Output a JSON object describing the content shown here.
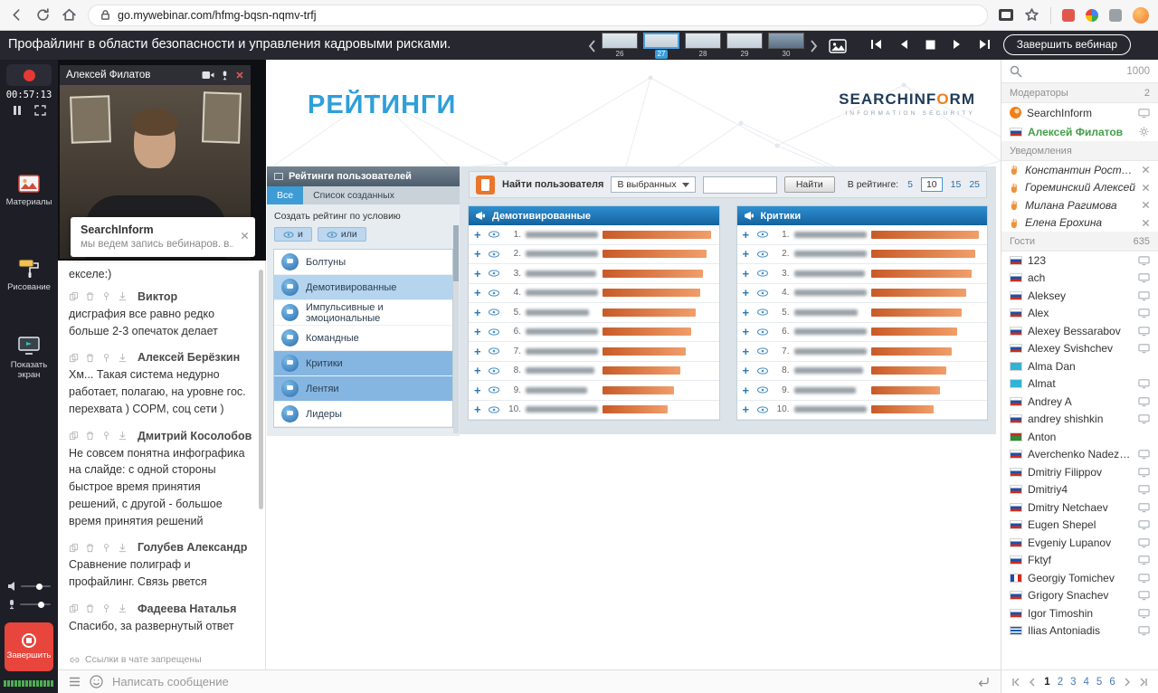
{
  "browser": {
    "url": "go.mywebinar.com/hfmg-bqsn-nqmv-trfj"
  },
  "header": {
    "title": "Профайлинг в области безопасности и управления кадровыми рисками.",
    "slide_numbers": [
      "26",
      "27",
      "28",
      "29",
      "30"
    ],
    "active_slide": "27",
    "end_webinar_label": "Завершить вебинар"
  },
  "left_rail": {
    "timer": "00:57:13",
    "materials_label": "Материалы",
    "drawing_label": "Рисование",
    "screen_label": "Показать экран",
    "end_label": "Завершить"
  },
  "video": {
    "presenter_name": "Алексей Филатов"
  },
  "chat": {
    "pinned": {
      "author": "SearchInform",
      "text": "мы ведем запись вебинаров. в..."
    },
    "partial_message": "екселе:)",
    "messages": [
      {
        "author": "Виктор",
        "text": "дисграфия все равно редко больше 2-3 опечаток делает"
      },
      {
        "author": "Алексей Берёзкин",
        "text": "Хм... Такая система недурно работает, полагаю, на уровне гос. перехвата ) СОРМ, соц сети )"
      },
      {
        "author": "Дмитрий Косолобов",
        "text": "Не совсем понятна инфографика на слайде: с одной стороны быстрое время принятия решений, с другой - большое время принятия решений"
      },
      {
        "author": "Голубев Александр",
        "text": "Сравнение полиграф и профайлинг. Связь рвется"
      },
      {
        "author": "Фадеева Наталья",
        "text": "Спасибо, за развернутый ответ"
      }
    ],
    "links_note": "Ссылки в чате запрещены",
    "input_placeholder": "Написать сообщение"
  },
  "slide": {
    "title": "РЕЙТИНГИ",
    "logo_part1": "SEARCHINF",
    "logo_o": "O",
    "logo_part2": "RM",
    "logo_tagline": "INFORMATION SECURITY",
    "app": {
      "panel_title": "Рейтинги пользователей",
      "tabs": [
        "Все",
        "Список созданных"
      ],
      "create_label": "Создать рейтинг по условию",
      "toggle_and": "и",
      "toggle_or": "или",
      "categories": [
        {
          "label": "Болтуны",
          "state": "none"
        },
        {
          "label": "Демотивированные",
          "state": "selected"
        },
        {
          "label": "Импульсивные и эмоциональные",
          "state": "none"
        },
        {
          "label": "Командные",
          "state": "none"
        },
        {
          "label": "Критики",
          "state": "active"
        },
        {
          "label": "Лентяи",
          "state": "active"
        },
        {
          "label": "Лидеры",
          "state": "none"
        }
      ],
      "toolbar": {
        "find_label": "Найти пользователя",
        "select_value": "В выбранных",
        "find_button": "Найти",
        "in_rating_label": "В рейтинге:",
        "page_sizes": [
          "5",
          "10",
          "15",
          "25"
        ],
        "page_size_selected": "10"
      },
      "tables": [
        {
          "title": "Демотивированные",
          "bars": [
            100,
            96,
            93,
            90,
            86,
            82,
            77,
            72,
            66,
            60
          ]
        },
        {
          "title": "Критики",
          "bars": [
            100,
            97,
            93,
            88,
            84,
            80,
            75,
            70,
            64,
            58
          ]
        }
      ]
    }
  },
  "participants": {
    "total_count": "1000",
    "moderators_label": "Модераторы",
    "moderators_count": "2",
    "moderators": [
      {
        "name": "SearchInform"
      },
      {
        "name": "Алексей Филатов"
      }
    ],
    "notifications_label": "Уведомления",
    "notifications": [
      {
        "name": "Константин Ростовский"
      },
      {
        "name": "Гореминский Алексей"
      },
      {
        "name": "Милана Рагимова"
      },
      {
        "name": "Елена Ерохина"
      }
    ],
    "guests_label": "Гости",
    "guests_count": "635",
    "guests": [
      {
        "name": "123",
        "flag": "ru",
        "device": true
      },
      {
        "name": "ach",
        "flag": "ru",
        "device": true
      },
      {
        "name": "Aleksey",
        "flag": "ru",
        "device": true
      },
      {
        "name": "Alex",
        "flag": "ru",
        "device": true
      },
      {
        "name": "Alexey Bessarabov",
        "flag": "ru",
        "device": true
      },
      {
        "name": "Alexey Svishchev",
        "flag": "ru",
        "device": true
      },
      {
        "name": "Alma Dan",
        "flag": "kz",
        "device": false
      },
      {
        "name": "Almat",
        "flag": "kz",
        "device": true
      },
      {
        "name": "Andrey A",
        "flag": "ru",
        "device": true
      },
      {
        "name": "andrey shishkin",
        "flag": "ru",
        "device": true
      },
      {
        "name": "Anton",
        "flag": "green",
        "device": false
      },
      {
        "name": "Averchenko Nadezhda",
        "flag": "ru",
        "device": true
      },
      {
        "name": "Dmitriy Filippov",
        "flag": "ru",
        "device": true
      },
      {
        "name": "Dmitriy4",
        "flag": "ru",
        "device": true
      },
      {
        "name": "Dmitry Netchaev",
        "flag": "ru",
        "device": true
      },
      {
        "name": "Eugen Shepel",
        "flag": "ru",
        "device": true
      },
      {
        "name": "Evgeniy Lupanov",
        "flag": "ru",
        "device": true
      },
      {
        "name": "Fktyf",
        "flag": "ru",
        "device": true
      },
      {
        "name": "Georgiy Tomichev",
        "flag": "fr",
        "device": true
      },
      {
        "name": "Grigory Snachev",
        "flag": "ru",
        "device": true
      },
      {
        "name": "Igor Timoshin",
        "flag": "ru",
        "device": true
      },
      {
        "name": "Ilias Antoniadis",
        "flag": "gr",
        "device": true
      }
    ],
    "pagination": [
      "1",
      "2",
      "3",
      "4",
      "5",
      "6"
    ],
    "pagination_active": "1"
  }
}
